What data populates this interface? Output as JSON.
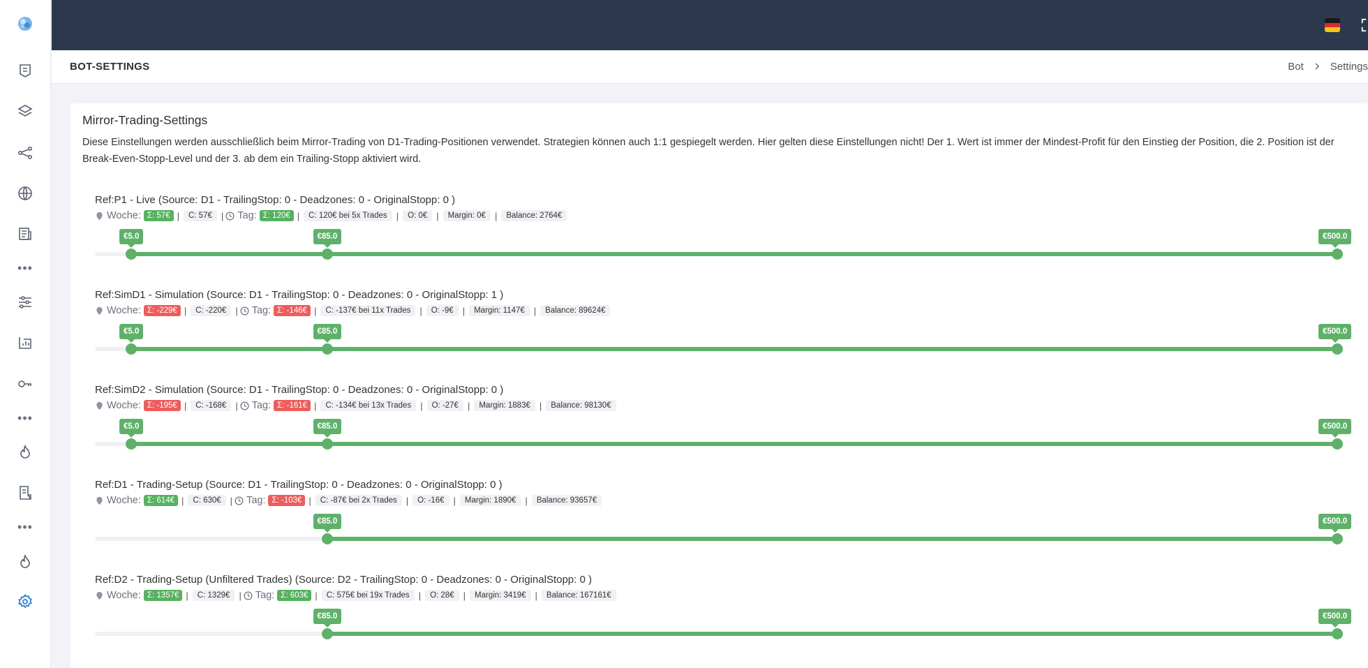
{
  "header": {
    "page_title": "BOT-SETTINGS",
    "breadcrumb": [
      "Bot",
      "Settings"
    ]
  },
  "card": {
    "title": "Mirror-Trading-Settings",
    "description": "Diese Einstellungen werden ausschließlich beim Mirror-Trading von D1-Trading-Positionen verwendet. Strategien können auch 1:1 gespiegelt werden. Hier gelten diese Einstellungen nicht! Der 1. Wert ist immer der Mindest-Profit für den Einstieg der Position, die 2. Position ist der Break-Even-Stopp-Level und der 3. ab dem ein Trailing-Stopp aktiviert wird."
  },
  "labels": {
    "week": "Woche:",
    "day": "Tag:"
  },
  "colors": {
    "green": "#56b161",
    "red": "#ee5c5c",
    "topbar": "#2b384d",
    "accent": "#3b82f6"
  },
  "slider_max": 500.0,
  "sections": [
    {
      "title": "Ref:P1 - Live (Source: D1 - TrailingStop: 0 - Deadzones: 0 - OriginalStopp: 0 )",
      "week_sum": "Σ: 57€",
      "week_sum_color": "green",
      "week_c": "C: 57€",
      "day_sum": "Σ: 120€",
      "day_sum_color": "green",
      "tags": [
        "C: 120€ bei 5x Trades",
        "O: 0€",
        "Margin: 0€",
        "Balance: 2764€"
      ],
      "values": [
        {
          "num": 5.0,
          "label": "€5.0"
        },
        {
          "num": 85.0,
          "label": "€85.0"
        },
        {
          "num": 500.0,
          "label": "€500.0"
        }
      ]
    },
    {
      "title": "Ref:SimD1 - Simulation (Source: D1 - TrailingStop: 0 - Deadzones: 0 - OriginalStopp: 1 )",
      "week_sum": "Σ: -229€",
      "week_sum_color": "red",
      "week_c": "C: -220€",
      "day_sum": "Σ: -146€",
      "day_sum_color": "red",
      "tags": [
        "C: -137€ bei 11x Trades",
        "O: -9€",
        "Margin: 1147€",
        "Balance: 89624€"
      ],
      "values": [
        {
          "num": 5.0,
          "label": "€5.0"
        },
        {
          "num": 85.0,
          "label": "€85.0"
        },
        {
          "num": 500.0,
          "label": "€500.0"
        }
      ]
    },
    {
      "title": "Ref:SimD2 - Simulation (Source: D1 - TrailingStop: 0 - Deadzones: 0 - OriginalStopp: 0 )",
      "week_sum": "Σ: -195€",
      "week_sum_color": "red",
      "week_c": "C: -168€",
      "day_sum": "Σ: -161€",
      "day_sum_color": "red",
      "tags": [
        "C: -134€ bei 13x Trades",
        "O: -27€",
        "Margin: 1883€",
        "Balance: 98130€"
      ],
      "values": [
        {
          "num": 5.0,
          "label": "€5.0"
        },
        {
          "num": 85.0,
          "label": "€85.0"
        },
        {
          "num": 500.0,
          "label": "€500.0"
        }
      ]
    },
    {
      "title": "Ref:D1 - Trading-Setup (Source: D1 - TrailingStop: 0 - Deadzones: 0 - OriginalStopp: 0 )",
      "week_sum": "Σ: 614€",
      "week_sum_color": "green",
      "week_c": "C: 630€",
      "day_sum": "Σ: -103€",
      "day_sum_color": "red",
      "tags": [
        "C: -87€ bei 2x Trades",
        "O: -16€",
        "Margin: 1890€",
        "Balance: 93657€"
      ],
      "values": [
        {
          "num": 85.0,
          "label": "€85.0"
        },
        {
          "num": 500.0,
          "label": "€500.0"
        }
      ]
    },
    {
      "title": "Ref:D2 - Trading-Setup (Unfiltered Trades) (Source: D2 - TrailingStop: 0 - Deadzones: 0 - OriginalStopp: 0 )",
      "week_sum": "Σ: 1357€",
      "week_sum_color": "green",
      "week_c": "C: 1329€",
      "day_sum": "Σ: 603€",
      "day_sum_color": "green",
      "tags": [
        "C: 575€ bei 19x Trades",
        "O: 28€",
        "Margin: 3419€",
        "Balance: 167161€"
      ],
      "values": [
        {
          "num": 85.0,
          "label": "€85.0"
        },
        {
          "num": 500.0,
          "label": "€500.0"
        }
      ]
    }
  ]
}
